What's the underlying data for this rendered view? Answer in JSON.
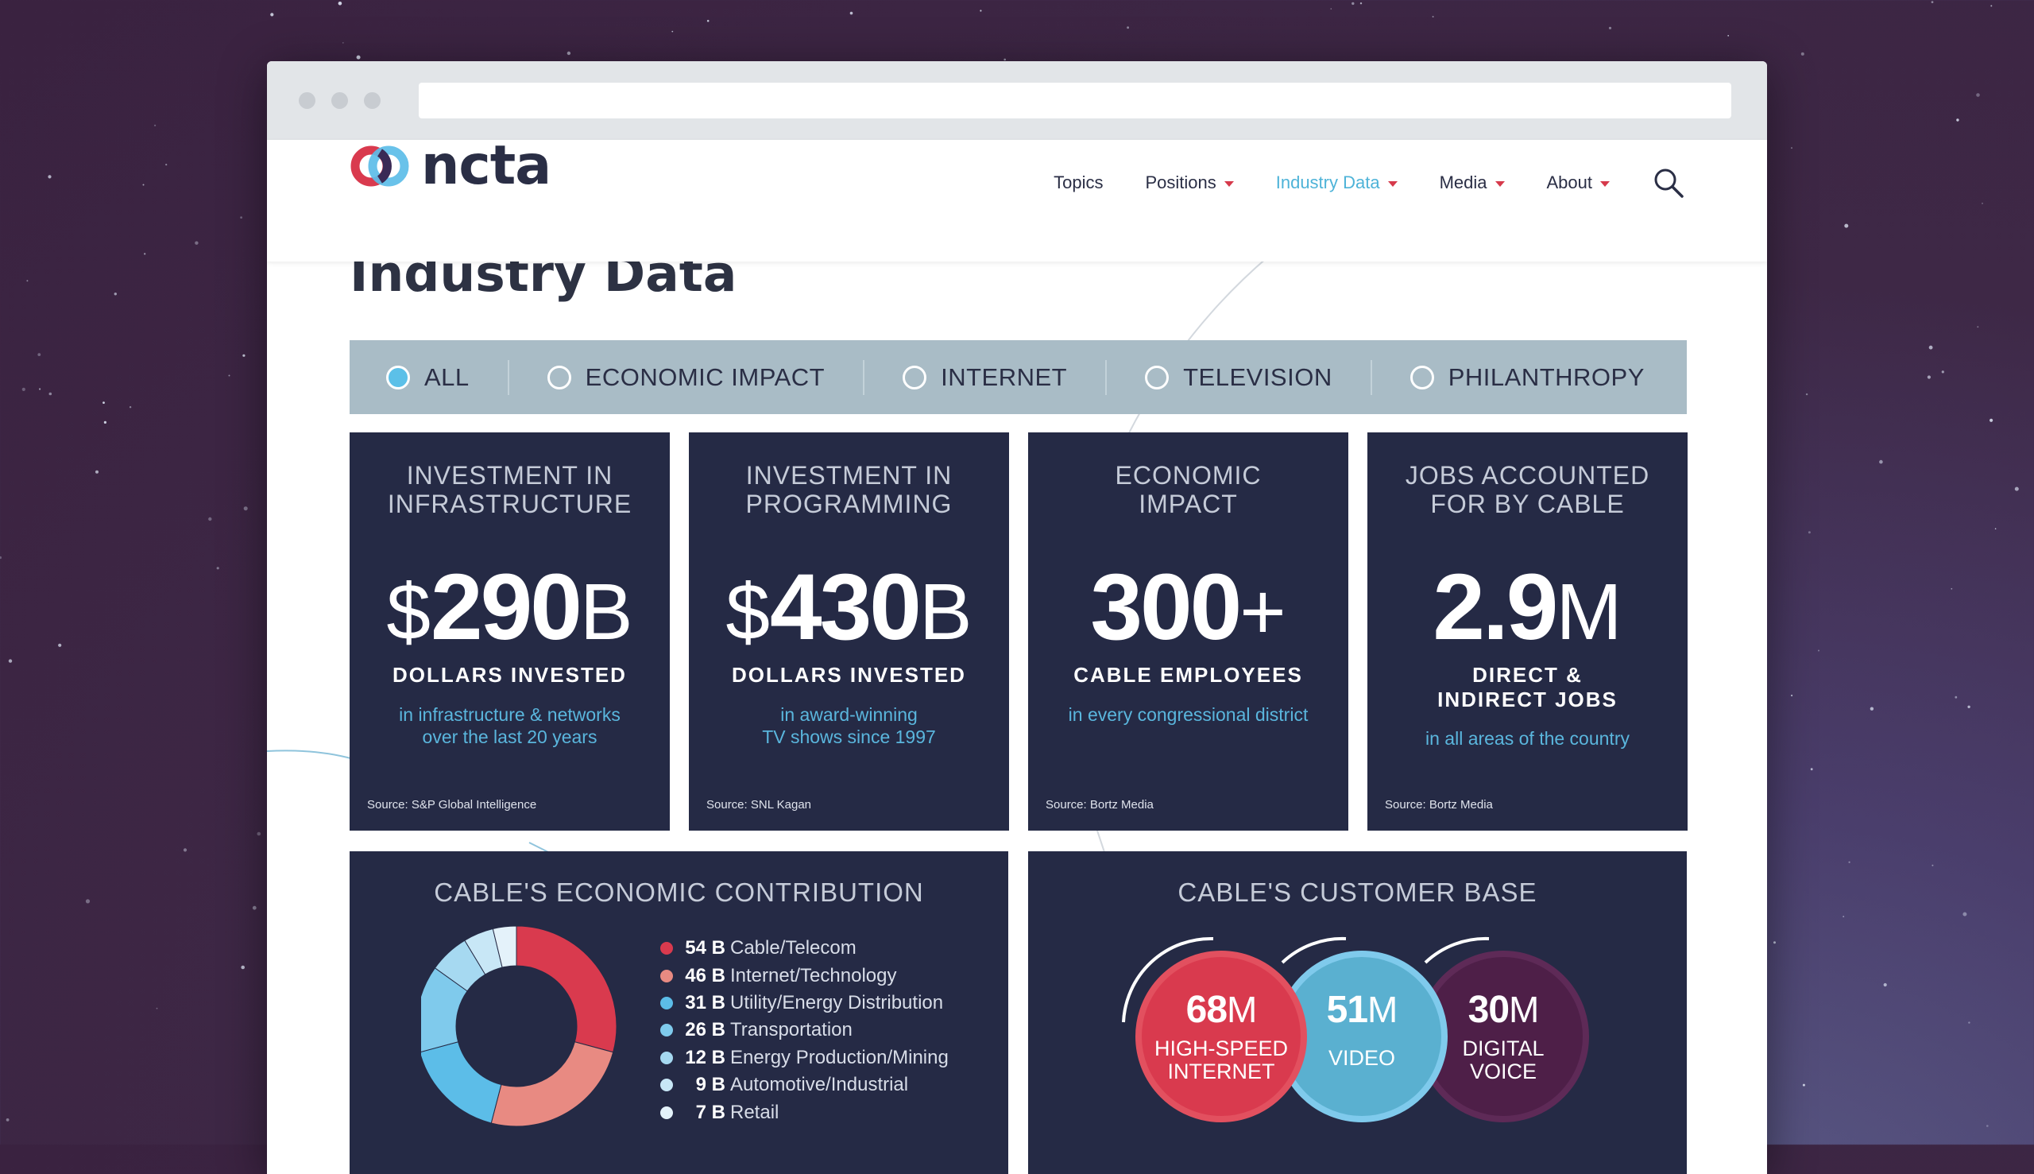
{
  "nav": {
    "logo_text": "ncta",
    "items": [
      {
        "label": "Topics",
        "dropdown": false,
        "active": false
      },
      {
        "label": "Positions",
        "dropdown": true,
        "active": false
      },
      {
        "label": "Industry Data",
        "dropdown": true,
        "active": true
      },
      {
        "label": "Media",
        "dropdown": true,
        "active": false
      },
      {
        "label": "About",
        "dropdown": true,
        "active": false
      }
    ],
    "search_icon": "search-icon"
  },
  "page": {
    "title": "Industry Data"
  },
  "filters": [
    {
      "label": "ALL",
      "checked": true
    },
    {
      "label": "ECONOMIC IMPACT",
      "checked": false
    },
    {
      "label": "INTERNET",
      "checked": false
    },
    {
      "label": "TELEVISION",
      "checked": false
    },
    {
      "label": "PHILANTHROPY",
      "checked": false
    }
  ],
  "cards": [
    {
      "title_line1": "INVESTMENT IN",
      "title_line2": "INFRASTRUCTURE",
      "prefix": "$",
      "number": "290",
      "unit": "B",
      "sub_line1": "DOLLARS INVESTED",
      "sub_line2": "",
      "desc_line1": "in infrastructure & networks",
      "desc_line2": "over the last 20 years",
      "source": "Source: S&P Global Intelligence"
    },
    {
      "title_line1": "INVESTMENT IN",
      "title_line2": "PROGRAMMING",
      "prefix": "$",
      "number": "430",
      "unit": "B",
      "sub_line1": "DOLLARS INVESTED",
      "sub_line2": "",
      "desc_line1": "in award-winning",
      "desc_line2": "TV shows since 1997",
      "source": "Source: SNL Kagan"
    },
    {
      "title_line1": "ECONOMIC",
      "title_line2": "IMPACT",
      "prefix": "",
      "number": "300",
      "unit": "+",
      "sub_line1": "CABLE EMPLOYEES",
      "sub_line2": "",
      "desc_line1": "in every congressional district",
      "desc_line2": "",
      "source": "Source: Bortz Media"
    },
    {
      "title_line1": "JOBS ACCOUNTED",
      "title_line2": "FOR BY CABLE",
      "prefix": "",
      "number": "2.9",
      "unit": "M",
      "sub_line1": "DIRECT &",
      "sub_line2": "INDIRECT JOBS",
      "desc_line1": "in all areas of the country",
      "desc_line2": "",
      "source": "Source: Bortz Media"
    }
  ],
  "economic_panel": {
    "title": "CABLE'S ECONOMIC CONTRIBUTION"
  },
  "chart_data": {
    "type": "pie",
    "donut": true,
    "categories": [
      "Cable/Telecom",
      "Internet/Technology",
      "Utility/Energy Distribution",
      "Transportation",
      "Energy Production/Mining",
      "Automotive/Industrial",
      "Retail"
    ],
    "values": [
      54,
      46,
      31,
      26,
      12,
      9,
      7
    ],
    "value_labels": [
      "54 B",
      "46 B",
      "31 B",
      "26 B",
      "12 B",
      "9 B",
      "7 B"
    ],
    "colors": [
      "#d93a4e",
      "#e88a82",
      "#5cbde8",
      "#7fcaec",
      "#a6d9f1",
      "#c8e7f6",
      "#e4f2fa"
    ]
  },
  "customer_panel": {
    "title": "CABLE'S CUSTOMER BASE",
    "bubbles": [
      {
        "number": "68",
        "unit": "M",
        "label_line1": "HIGH-SPEED",
        "label_line2": "INTERNET",
        "color": "#d93a4e"
      },
      {
        "number": "51",
        "unit": "M",
        "label_line1": "VIDEO",
        "label_line2": "",
        "color": "#5ab0d0"
      },
      {
        "number": "30",
        "unit": "M",
        "label_line1": "DIGITAL",
        "label_line2": "VOICE",
        "color": "#4e1f48"
      }
    ]
  }
}
